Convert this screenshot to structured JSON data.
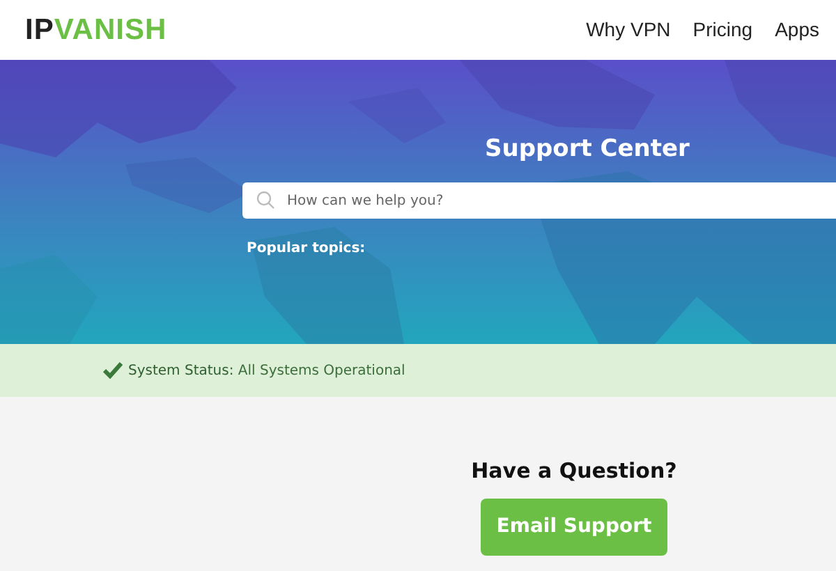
{
  "header": {
    "logo": {
      "dark": "IP",
      "accent": "VANISH"
    },
    "nav": [
      "Why VPN",
      "Pricing",
      "Apps"
    ]
  },
  "hero": {
    "title": "Support Center",
    "search": {
      "placeholder": "How can we help you?"
    },
    "popular_label": "Popular topics:"
  },
  "status": {
    "operational": true,
    "label": "System Status:",
    "value": "All Systems Operational"
  },
  "contact": {
    "heading": "Have a Question?",
    "button": "Email Support"
  }
}
